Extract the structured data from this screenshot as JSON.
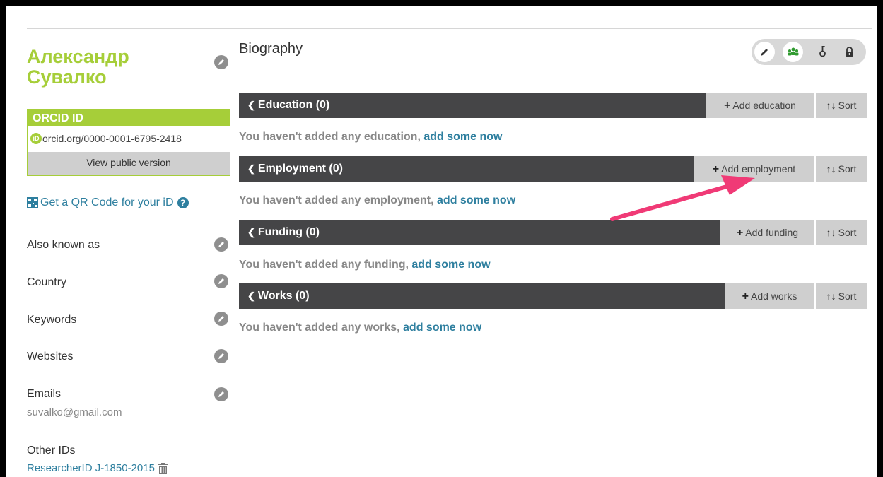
{
  "profile": {
    "name": "Александр Сувалко",
    "orcid_label": "ORCID ID",
    "orcid_icon": "iD",
    "orcid_url": "orcid.org/0000-0001-6795-2418",
    "view_public": "View public version",
    "qr_link": "Get a QR Code for your iD",
    "help_glyph": "?"
  },
  "sidebar": {
    "also_known_as": "Also known as",
    "country": "Country",
    "keywords": "Keywords",
    "websites": "Websites",
    "emails": "Emails",
    "email_value": "suvalko@gmail.com",
    "other_ids": "Other IDs",
    "researcher_id": "ResearcherID J-1850-2015"
  },
  "main": {
    "biography_title": "Biography",
    "sections": [
      {
        "title": "Education (0)",
        "add_label": "Add education",
        "sort_label": "Sort",
        "empty_text": "You haven't added any education, ",
        "add_link": "add some now"
      },
      {
        "title": "Employment (0)",
        "add_label": "Add employment",
        "sort_label": "Sort",
        "empty_text": "You haven't added any employment, ",
        "add_link": "add some now"
      },
      {
        "title": "Funding (0)",
        "add_label": "Add funding",
        "sort_label": "Sort",
        "empty_text": "You haven't added any funding, ",
        "add_link": "add some now"
      },
      {
        "title": "Works (0)",
        "add_label": "Add works",
        "sort_label": "Sort",
        "empty_text": "You haven't added any works, ",
        "add_link": "add some now"
      }
    ]
  },
  "icons": {
    "edit": "pencil-icon",
    "visibility_edit": "pencil-icon",
    "visibility_public": "people-icon",
    "visibility_limited": "trusted-key-icon",
    "visibility_private": "lock-icon",
    "chevron": "chevron-down-icon",
    "add": "plus-icon",
    "sort": "sort-icon",
    "qr": "qr-code-icon",
    "help": "help-icon",
    "delete": "trash-icon",
    "annotation": "arrow-annotation"
  },
  "colors": {
    "brand_green": "#a6ce39",
    "link_blue": "#2e7f9f",
    "section_bar": "#454547",
    "button_gray": "#cfcfcf",
    "annotation_pink": "#f03a76",
    "public_green": "#2f9a2f"
  }
}
